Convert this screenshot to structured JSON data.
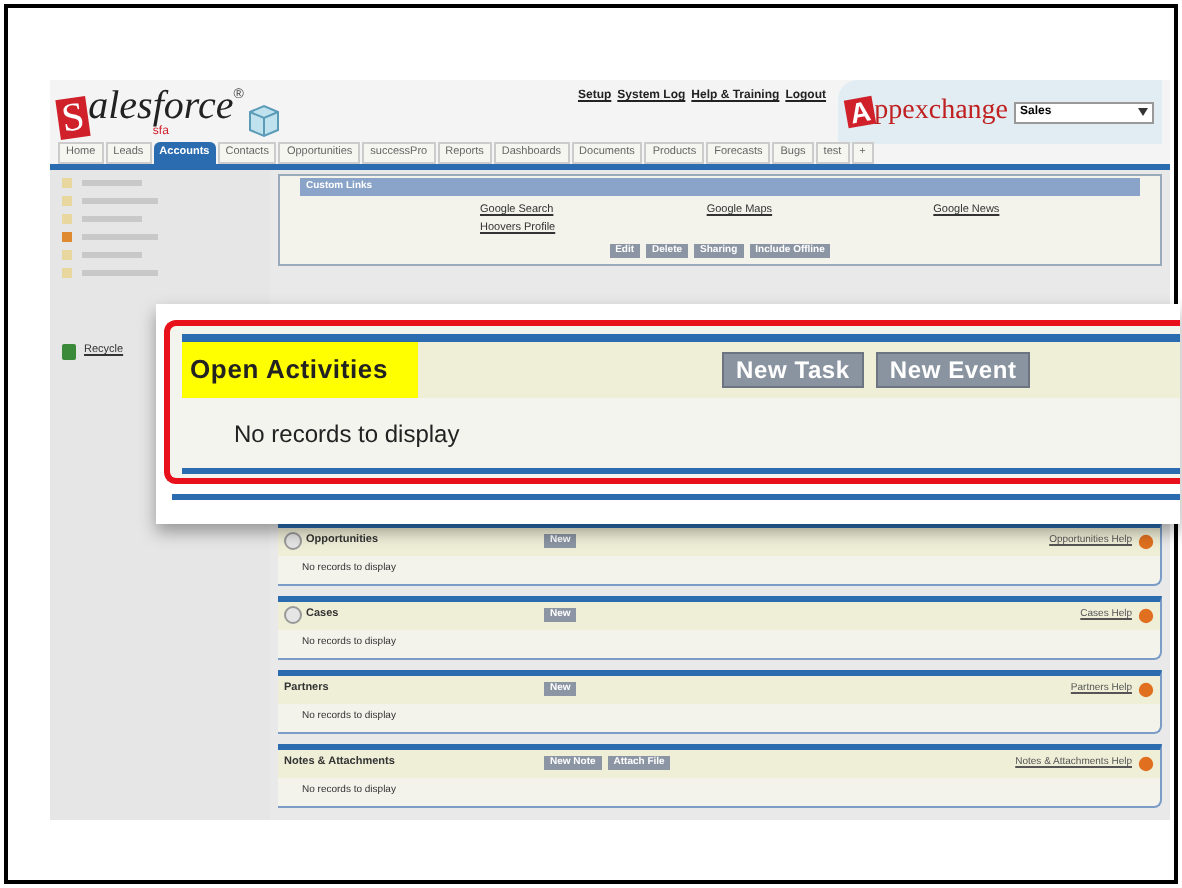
{
  "logo": {
    "initial": "S",
    "rest": "alesforce",
    "mark": "®",
    "edition": "sfa"
  },
  "header": {
    "links": [
      "Setup",
      "System Log",
      "Help & Training",
      "Logout"
    ],
    "appexchange": {
      "initial": "A",
      "rest": "ppexchange"
    },
    "app_select": "Sales"
  },
  "tabs": [
    {
      "label": "Home",
      "selected": false
    },
    {
      "label": "Leads",
      "selected": false
    },
    {
      "label": "Accounts",
      "selected": true
    },
    {
      "label": "Contacts",
      "selected": false
    },
    {
      "label": "Opportunities",
      "selected": false
    },
    {
      "label": "successPro",
      "selected": false
    },
    {
      "label": "Reports",
      "selected": false
    },
    {
      "label": "Dashboards",
      "selected": false
    },
    {
      "label": "Documents",
      "selected": false
    },
    {
      "label": "Products",
      "selected": false
    },
    {
      "label": "Forecasts",
      "selected": false
    },
    {
      "label": "Bugs",
      "selected": false
    },
    {
      "label": "test",
      "selected": false
    },
    {
      "label": "+",
      "selected": false
    }
  ],
  "sidebar": {
    "recycle_link": "Recycle"
  },
  "custom_links": {
    "title": "Custom Links",
    "links": [
      "Google Search",
      "Google Maps",
      "Google News",
      "Hoovers Profile"
    ],
    "buttons": [
      "Edit",
      "Delete",
      "Sharing",
      "Include Offline"
    ]
  },
  "sections": [
    {
      "title": "Opportunities",
      "has_icon": true,
      "buttons": [
        "New"
      ],
      "help": "Opportunities Help",
      "message": "No records to display"
    },
    {
      "title": "Cases",
      "has_icon": true,
      "buttons": [
        "New"
      ],
      "help": "Cases Help",
      "message": "No records to display"
    },
    {
      "title": "Partners",
      "has_icon": false,
      "buttons": [
        "New"
      ],
      "help": "Partners Help",
      "message": "No records to display"
    },
    {
      "title": "Notes & Attachments",
      "has_icon": false,
      "buttons": [
        "New Note",
        "Attach File"
      ],
      "help": "Notes & Attachments Help",
      "message": "No records to display"
    }
  ],
  "callout": {
    "title": "Open Activities",
    "buttons": [
      "New Task",
      "New Event"
    ],
    "message": "No records to display"
  }
}
